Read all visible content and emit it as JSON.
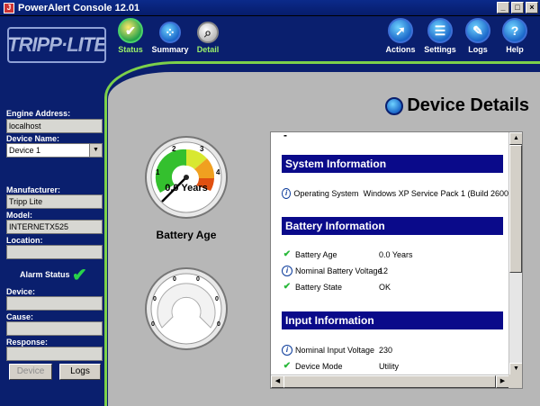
{
  "window": {
    "title": "PowerAlert Console 12.01",
    "min": "_",
    "max": "□",
    "close": "×"
  },
  "brand": {
    "logo": "TRIPP·LITE"
  },
  "toolbar": {
    "status": "Status",
    "summary": "Summary",
    "detail": "Detail",
    "actions": "Actions",
    "settings": "Settings",
    "logs": "Logs",
    "help": "Help"
  },
  "sidebar": {
    "engine_address_label": "Engine Address:",
    "engine_address": "localhost",
    "device_name_label": "Device Name:",
    "device_name": "Device 1",
    "manufacturer_label": "Manufacturer:",
    "manufacturer": "Tripp Lite",
    "model_label": "Model:",
    "model": "INTERNETX525",
    "location_label": "Location:",
    "location": "",
    "alarm_status_label": "Alarm Status",
    "device_label": "Device:",
    "device": "",
    "cause_label": "Cause:",
    "cause": "",
    "response_label": "Response:",
    "response": "",
    "device_button": "Device",
    "logs_button": "Logs"
  },
  "page": {
    "title": "Device Details"
  },
  "gauge_top": {
    "label": "Battery Age",
    "readout": "0.0 Years",
    "ticks": [
      "1",
      "2",
      "3",
      "4"
    ],
    "value_fraction": 0.0
  },
  "gauge_bottom": {
    "ticks": [
      "0",
      "0",
      "0",
      "0",
      "0",
      "0"
    ]
  },
  "details": {
    "dash": "-",
    "system": {
      "title": "System Information",
      "rows": [
        {
          "label": "Operating System",
          "value": "Windows XP Service Pack 1 (Build 2600)"
        }
      ]
    },
    "battery": {
      "title": "Battery Information",
      "rows": [
        {
          "label": "Battery Age",
          "value": "0.0 Years"
        },
        {
          "label": "Nominal Battery Voltage",
          "value": "12"
        },
        {
          "label": "Battery State",
          "value": "OK"
        }
      ]
    },
    "input": {
      "title": "Input Information",
      "rows": [
        {
          "label": "Nominal Input Voltage",
          "value": "230"
        },
        {
          "label": "Device Mode",
          "value": "Utility"
        }
      ]
    }
  },
  "colors": {
    "navy": "#0a1f6e",
    "accent_green": "#7cd04a",
    "section_blue": "#0a0a8a"
  }
}
